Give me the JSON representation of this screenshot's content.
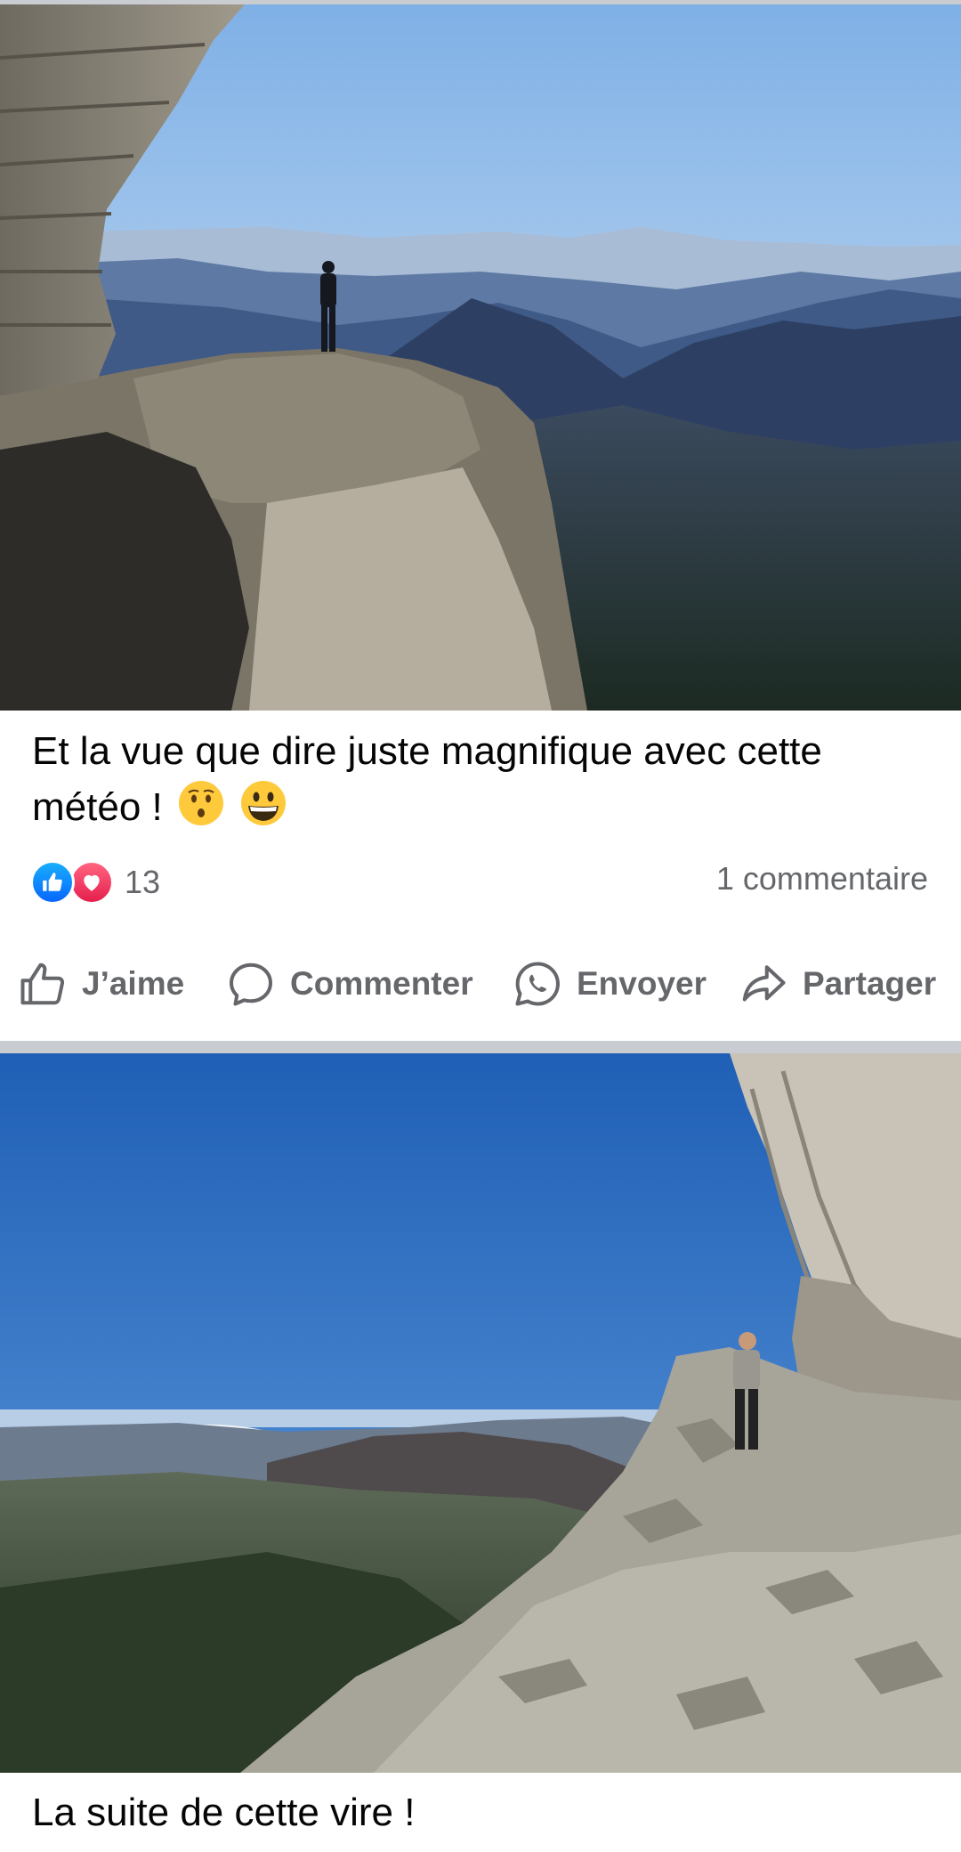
{
  "posts": [
    {
      "caption": "Et la vue que dire juste magnifique avec cette météo !",
      "emojis": [
        "face-with-open-mouth-emoji",
        "grinning-face-emoji"
      ],
      "reaction_types": [
        "like",
        "love"
      ],
      "reaction_count": "13",
      "comments_label": "1 commentaire",
      "actions": {
        "like": "J’aime",
        "comment": "Commenter",
        "send": "Envoyer",
        "share": "Partager"
      }
    },
    {
      "caption": "La suite de cette vire !"
    }
  ],
  "colors": {
    "like_blue": "#0866ff",
    "love_red": "#e61e4d",
    "secondary_text": "#65676b",
    "separator": "#c9ccd1"
  }
}
